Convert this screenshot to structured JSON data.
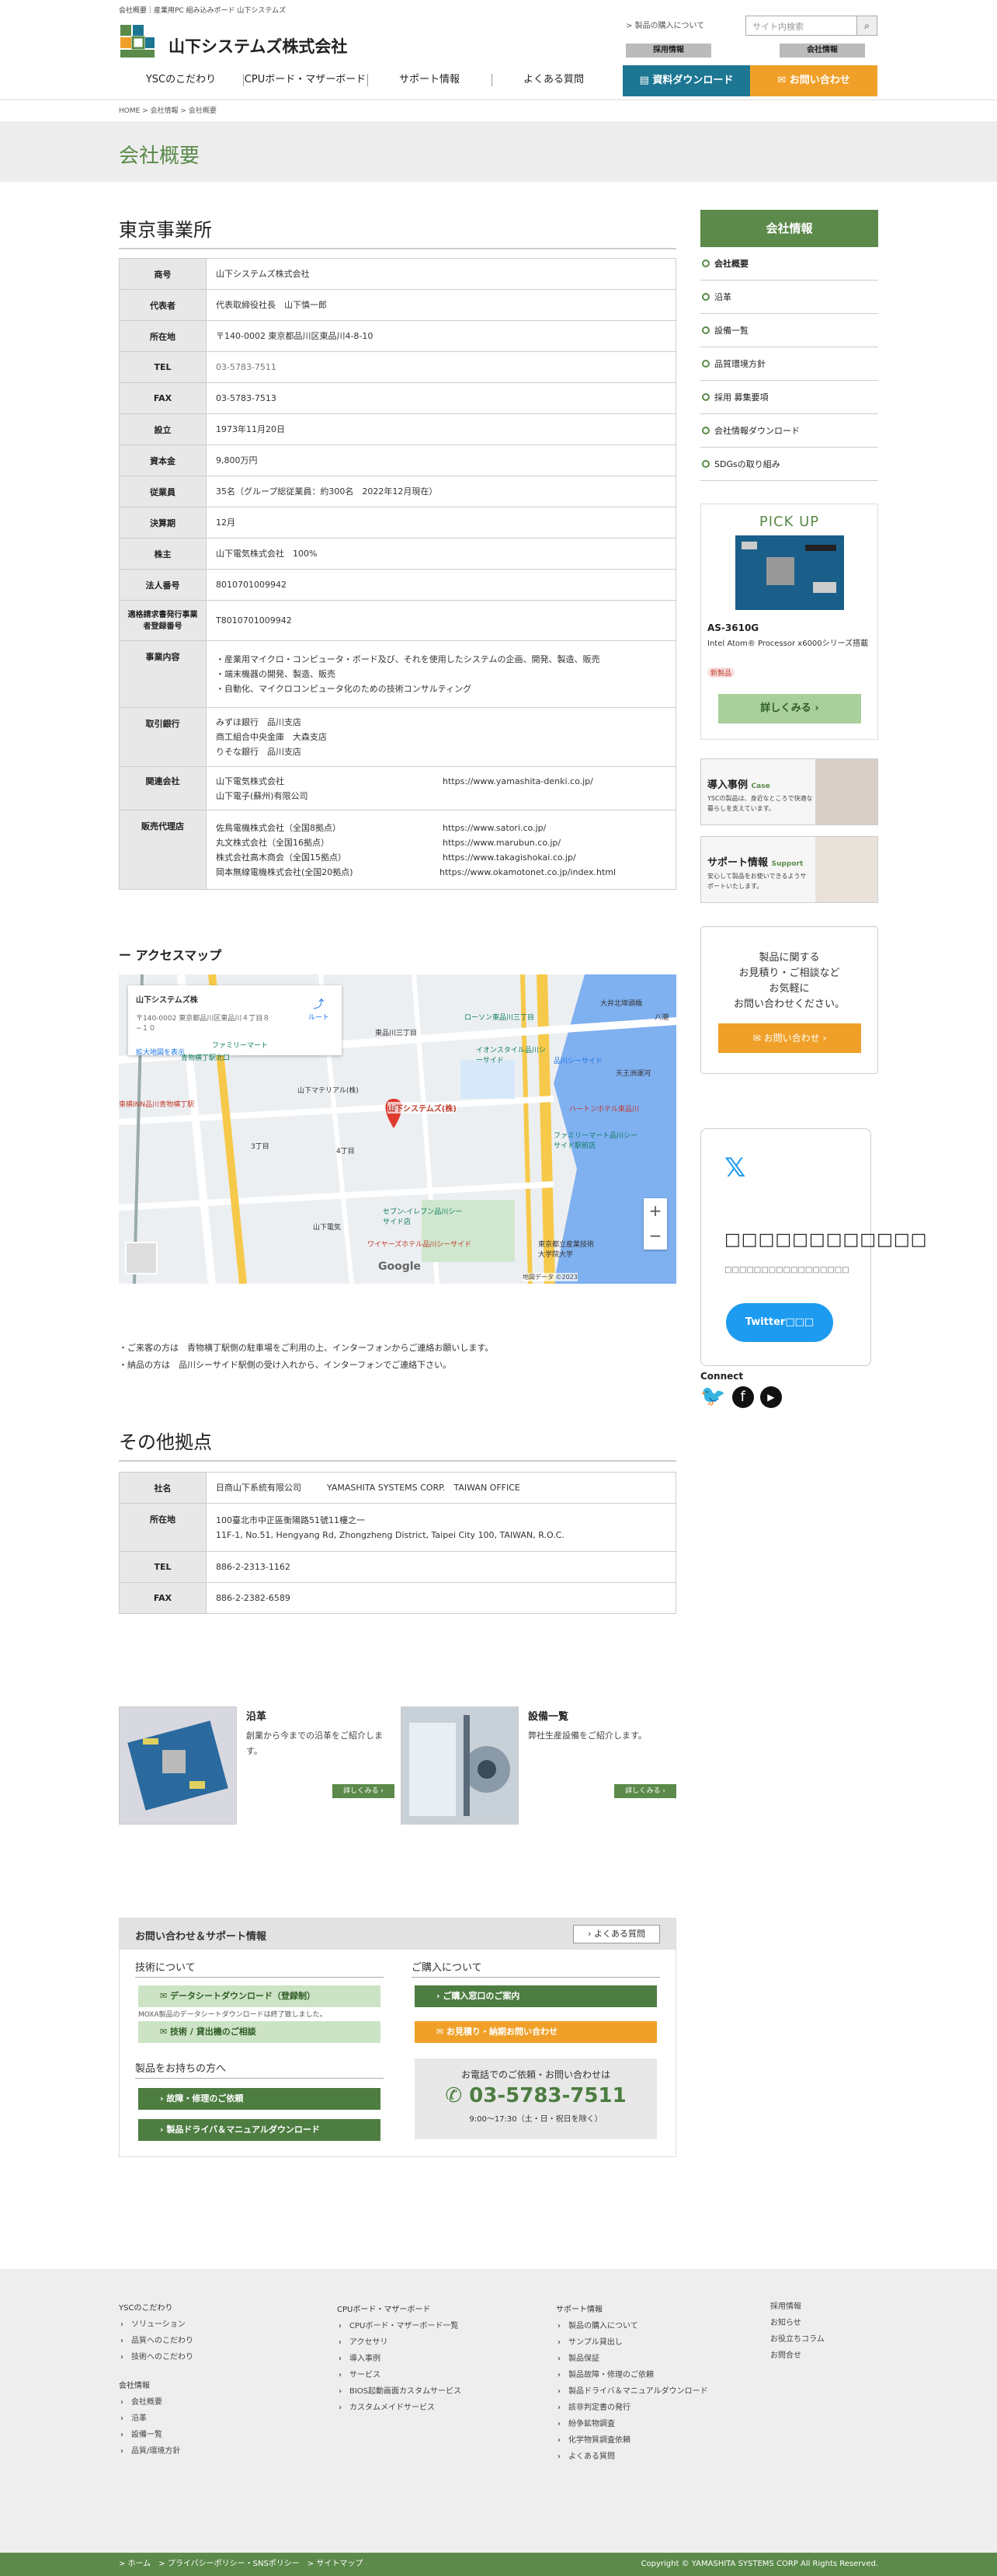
{
  "topline": "会社概要｜産業用PC 組み込みボード 山下システムズ",
  "logo": {
    "name": "山下システムズ株式会社"
  },
  "header": {
    "about_link": "> 製品の購入について",
    "search_placeholder": "サイト内検索",
    "recruit": "採用情報",
    "company": "会社情報",
    "download": "資料ダウンロード",
    "contact": "お問い合わせ"
  },
  "gnav": [
    "YSCのこだわり",
    "CPUボード・マザーボード",
    "サポート情報",
    "よくある質問"
  ],
  "breadcrumb": "HOME > 会社情報 > 会社概要",
  "page_title": "会社概要",
  "tokyo": {
    "heading": "東京事業所",
    "rows": [
      {
        "k": "商号",
        "v": "山下システムズ株式会社"
      },
      {
        "k": "代表者",
        "v": "代表取締役社長　山下慎一郎"
      },
      {
        "k": "所在地",
        "v": "〒140-0002 東京都品川区東品川4-8-10"
      },
      {
        "k": "TEL",
        "v": "03-5783-7511"
      },
      {
        "k": "FAX",
        "v": "03-5783-7513"
      },
      {
        "k": "設立",
        "v": "1973年11月20日"
      },
      {
        "k": "資本金",
        "v": "9,800万円"
      },
      {
        "k": "従業員",
        "v": "35名（グループ総従業員：約300名　2022年12月現在）"
      },
      {
        "k": "決算期",
        "v": "12月"
      },
      {
        "k": "株主",
        "v": "山下電気株式会社　100%"
      },
      {
        "k": "法人番号",
        "v": "8010701009942"
      },
      {
        "k": "適格請求書発行事業者登録番号",
        "v": "T8010701009942"
      }
    ],
    "business_label": "事業内容",
    "business": [
      "・産業用マイクロ・コンピュータ・ボード及び、それを使用したシステムの企画、開発、製造、販売",
      "・端末機器の開発、製造、販売",
      "・自動化、マイクロコンピュータ化のための技術コンサルティング"
    ],
    "bank_label": "取引銀行",
    "banks": [
      "みずほ銀行　品川支店",
      "商工組合中央金庫　大森支店",
      "りそな銀行　品川支店"
    ],
    "related_label": "関連会社",
    "related": [
      {
        "n": "山下電気株式会社",
        "u": "https://www.yamashita-denki.co.jp/"
      },
      {
        "n": "山下電子(蘇州)有限公司",
        "u": ""
      }
    ],
    "agency_label": "販売代理店",
    "agencies": [
      {
        "n": "佐鳥電機株式会社（全国8拠点）",
        "u": "https://www.satori.co.jp/"
      },
      {
        "n": "丸文株式会社（全国16拠点）",
        "u": "https://www.marubun.co.jp/"
      },
      {
        "n": "株式会社高木商会（全国15拠点）",
        "u": "https://www.takagishokai.co.jp/"
      },
      {
        "n": "岡本無線電機株式会社(全国20拠点)",
        "u": "https://www.okamotonet.co.jp/index.html"
      }
    ]
  },
  "access": {
    "heading": "アクセスマップ",
    "card_title": "山下システムズ株",
    "card_addr": "〒140-0002 東京都品川区東品川４丁目８−１０",
    "card_link": "拡大地図を表示",
    "route": "ルート",
    "labels": {
      "shinagawa": "東品川三丁目",
      "aomono": "青物横丁駅北口",
      "inn": "東横INN品川青物横丁駅",
      "marker": "山下システムズ(株)",
      "denki": "山下電気",
      "hotel": "ワイヤーズホテル品川シーサイド",
      "seaside": "品川シーサイド",
      "mates": "山下マテリアル(株)",
      "aeon": "イオンスタイル品川シーサイド",
      "family": "ファミリーマート",
      "lawson": "ローソン東品川三丁目",
      "seven": "セブン-イレブン品川シーサイド店",
      "univ": "東京都立産業技術大学院大学",
      "ooi": "大井北埠頭橋",
      "yashio": "八潮",
      "tenno": "天王洲運河",
      "family2": "ファミリーマート品川シーサイド駅前店",
      "google": "Google",
      "copyright": "地図データ ©2023",
      "sanchome": "3丁目",
      "yonchome": "4丁目",
      "heart": "ハートンホテル東品川"
    },
    "zoom_in": "+",
    "zoom_out": "−"
  },
  "notes": [
    "・ご来客の方は　青物横丁駅側の駐車場をご利用の上、インターフォンからご連絡お願いします。",
    "・納品の方は　品川シーサイド駅側の受け入れから、インターフォンでご連絡下さい。"
  ],
  "other": {
    "heading": "その他拠点",
    "rows": [
      {
        "k": "社名",
        "v": "日商山下系統有限公司　　　YAMASHITA SYSTEMS CORP.　TAIWAN OFFICE"
      },
      {
        "k": "所在地",
        "v": "100臺北市中正區衡陽路51號11樓之一",
        "v2": "11F-1, No.51, Hengyang Rd, Zhongzheng District, Taipei City 100, TAIWAN, R.O.C."
      },
      {
        "k": "TEL",
        "v": "886-2-2313-1162"
      },
      {
        "k": "FAX",
        "v": "886-2-2382-6589"
      }
    ]
  },
  "features": [
    {
      "title": "沿革",
      "desc": "創業から今までの沿革をご紹介します。",
      "more": "詳しくみる ›"
    },
    {
      "title": "設備一覧",
      "desc": "弊社生産設備をご紹介します。",
      "more": "詳しくみる ›"
    }
  ],
  "inquiry": {
    "bar": "お問い合わせ＆サポート情報",
    "faq": "よくある質問",
    "tech": "技術について",
    "dl": "データシートダウンロード（登録制）",
    "dl_note": "MOXA製品のデータシートダウンロードは終了致しました。",
    "tech_consult": "技術 / 貸出機のご相談",
    "owners": "製品をお持ちの方へ",
    "repair": "故障・修理のご依頼",
    "driver": "製品ドライバ＆マニュアルダウンロード",
    "purchase": "ご購入について",
    "shop": "ご購入窓口のご案内",
    "quote": "お見積り・納期お問い合わせ",
    "phone_lead": "お電話でのご依頼・お問い合わせは",
    "phone": "03-5783-7511",
    "hours": "9:00〜17:30（土・日・祝日を除く）"
  },
  "sidebar": {
    "head": "会社情報",
    "items": [
      "会社概要",
      "沿革",
      "設備一覧",
      "品質環境方針",
      "採用 募集要項",
      "会社情報ダウンロード",
      "SDGsの取り組み"
    ],
    "pickup": {
      "label": "PICK UP",
      "model": "AS-3610G",
      "desc": "Intel Atom® Processor x6000シリーズ搭載",
      "badge": "新製品",
      "more": "詳しくみる"
    },
    "case": {
      "title": "導入事例",
      "tag": "Case",
      "desc": "YSCの製品は、身近なところで快適な暮らしを支えています。"
    },
    "support": {
      "title": "サポート情報",
      "tag": "Support",
      "desc": "安心して製品をお使いできるようサポートいたします。"
    },
    "contact": {
      "lines": [
        "製品に関する",
        "お見積り・ご相談など",
        "お気軽に",
        "お問い合わせください。"
      ],
      "btn": "お問い合わせ"
    },
    "twitter": {
      "title": "□□□□□□□□□□□□",
      "sub": "□□□□□□□□□□□□□□□□□",
      "btn": "Twitter□□□"
    },
    "connect": "Connect"
  },
  "footer": {
    "col1": {
      "hd": "YSCのこだわり",
      "items": [
        "ソリューション",
        "品質へのこだわり",
        "技術へのこだわり"
      ]
    },
    "col1b": {
      "hd": "会社情報",
      "items": [
        "会社概要",
        "沿革",
        "設備一覧",
        "品質/環境方針"
      ]
    },
    "col2": {
      "hd": "CPUボード・マザーボード",
      "items": [
        "CPUボード・マザーボード一覧",
        "アクセサリ",
        "導入事例",
        "サービス",
        "BIOS起動画面カスタムサービス",
        "カスタムメイドサービス"
      ]
    },
    "col3": {
      "hd": "サポート情報",
      "items": [
        "製品の購入について",
        "サンプル貸出し",
        "製品保証",
        "製品故障・修理のご依頼",
        "製品ドライバ＆マニュアルダウンロード",
        "該非判定書の発行",
        "紛争鉱物調査",
        "化学物質調査依頼",
        "よくある質問"
      ]
    },
    "col4": {
      "items": [
        "採用情報",
        "お知らせ",
        "お役立ちコラム",
        "お問合せ"
      ]
    },
    "bottom_links": "> ホーム　> プライバシーポリシー・SNSポリシー　> サイトマップ",
    "copyright": "Copyright © YAMASHITA SYSTEMS CORP All Rights Reserved."
  },
  "colors": {
    "green": "#5b8a4a",
    "teal": "#1d7793",
    "orange": "#f0a028"
  }
}
